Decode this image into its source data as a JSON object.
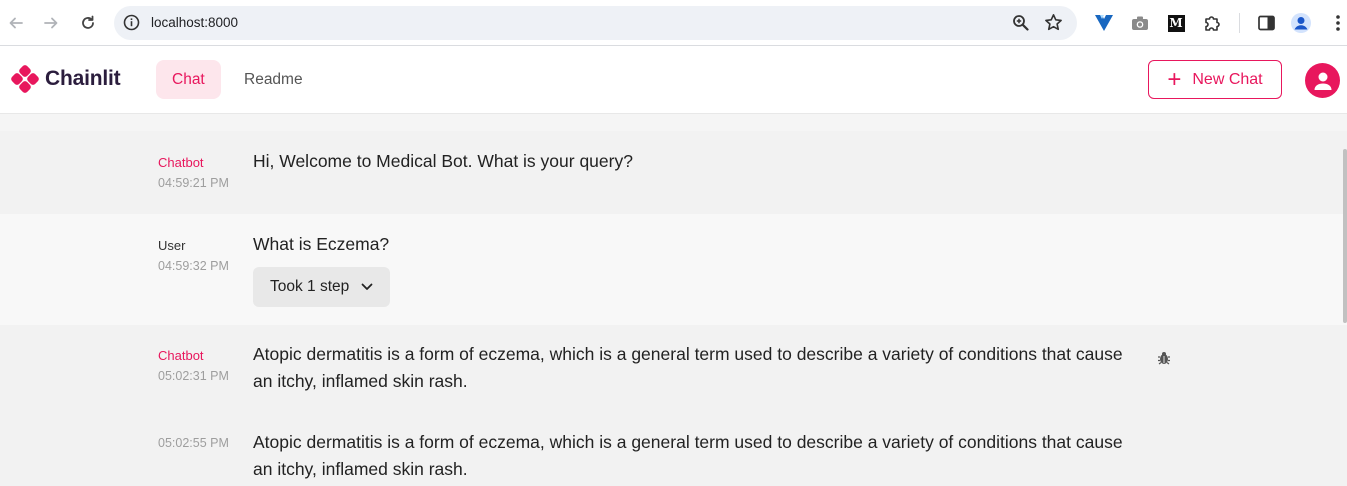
{
  "browser": {
    "url": "localhost:8000",
    "icons": [
      "back-icon",
      "forward-icon",
      "reload-icon",
      "site-info-icon",
      "zoom-icon",
      "bookmark-star-icon",
      "vuetify-extension-icon",
      "camera-extension-icon",
      "medium-extension-icon",
      "extensions-puzzle-icon",
      "side-panel-icon",
      "profile-icon",
      "menu-kebab-icon"
    ],
    "medium_label": "M"
  },
  "app": {
    "brand": "Chainlit",
    "tabs": [
      {
        "label": "Chat",
        "active": true
      },
      {
        "label": "Readme",
        "active": false
      }
    ],
    "new_chat_label": "New Chat",
    "accent_color": "#e8175d"
  },
  "messages": [
    {
      "author": "Chatbot",
      "time": "04:59:21 PM",
      "text": "Hi, Welcome to Medical Bot. What is your query?"
    },
    {
      "author": "User",
      "time": "04:59:32 PM",
      "text": "What is Eczema?",
      "step_label": "Took 1 step"
    },
    {
      "author": "Chatbot",
      "time": "05:02:31 PM",
      "text": "Atopic dermatitis is a form of eczema, which is a general term used to describe a variety of conditions that cause an itchy, inflamed skin rash."
    },
    {
      "author": "",
      "time": "05:02:55 PM",
      "text": "Atopic dermatitis is a form of eczema, which is a general term used to describe a variety of conditions that cause an itchy, inflamed skin rash."
    }
  ]
}
